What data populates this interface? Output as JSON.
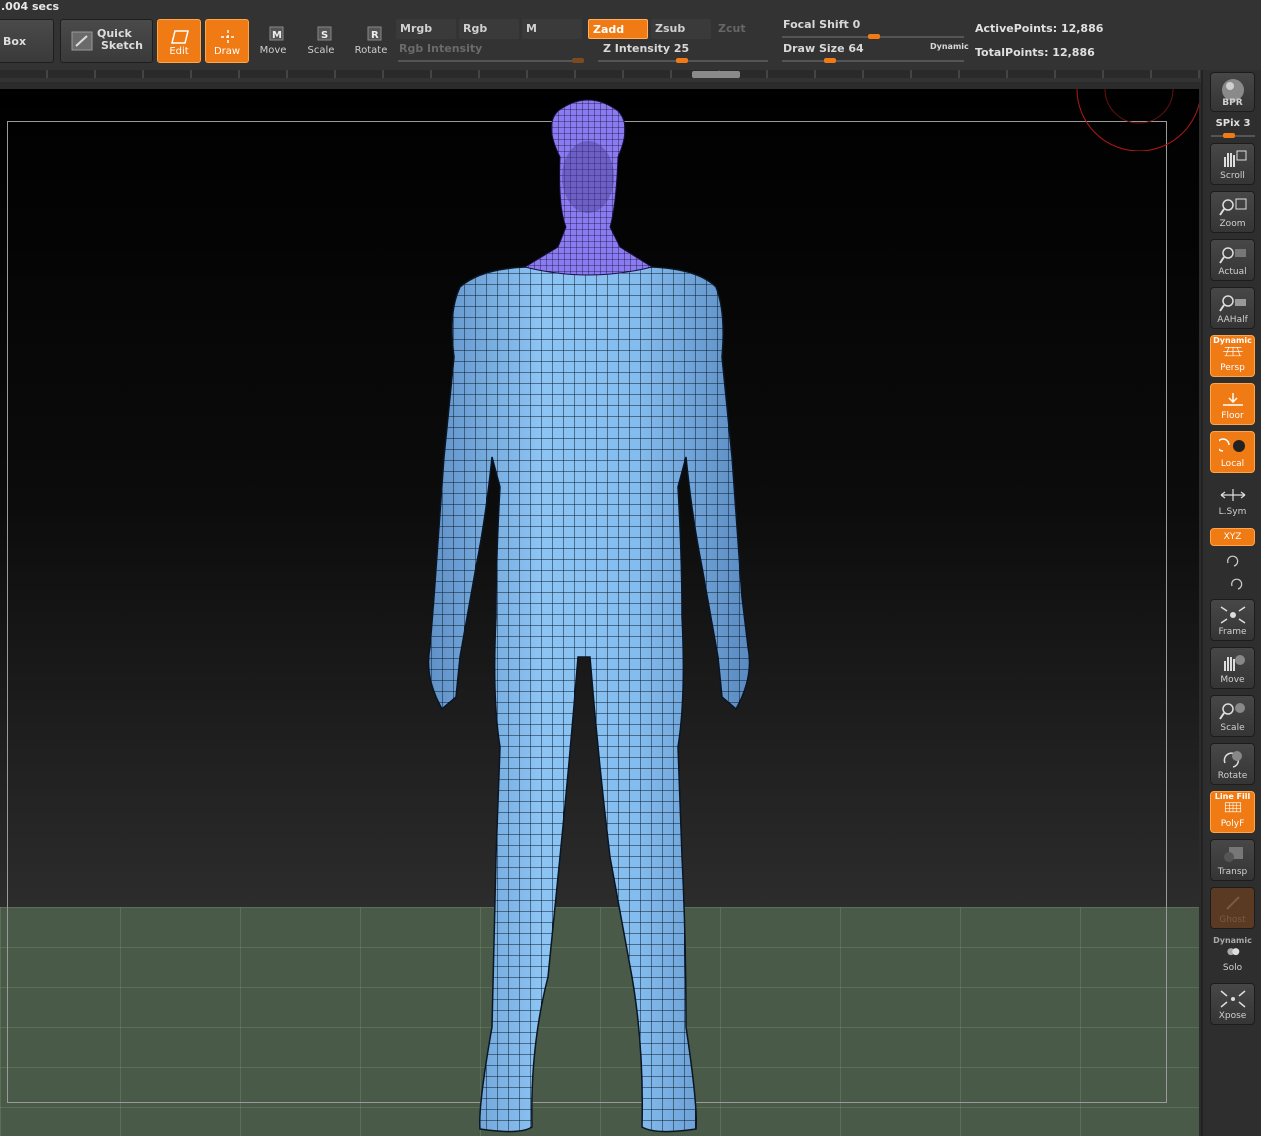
{
  "timer": ".004 secs",
  "top_buttons": {
    "box": "Box",
    "quick_sketch_1": "Quick",
    "quick_sketch_2": "Sketch",
    "edit": "Edit",
    "draw": "Draw",
    "move": "Move",
    "scale": "Scale",
    "rotate": "Rotate"
  },
  "modes": {
    "mrgb": "Mrgb",
    "rgb": "Rgb",
    "m": "M",
    "zadd": "Zadd",
    "zsub": "Zsub",
    "zcut": "Zcut"
  },
  "sliders": {
    "rgb_intensity": "Rgb  Intensity",
    "z_intensity": "Z  Intensity 25",
    "focal_shift": "Focal  Shift 0",
    "draw_size": "Draw  Size 64",
    "dynamic": "Dynamic"
  },
  "values": {
    "z_intensity": 25,
    "focal_shift": 0,
    "draw_size": 64
  },
  "info": {
    "active_points": "ActivePoints: 12,886",
    "total_points": "TotalPoints: 12,886"
  },
  "shelf": {
    "bpr": "BPR",
    "spix": "SPix 3",
    "scroll": "Scroll",
    "zoom": "Zoom",
    "actual": "Actual",
    "aahalf": "AAHalf",
    "persp_top": "Dynamic",
    "persp": "Persp",
    "floor": "Floor",
    "local": "Local",
    "lsym": "L.Sym",
    "xyz": "XYZ",
    "frame": "Frame",
    "move": "Move",
    "scale": "Scale",
    "rotate": "Rotate",
    "polyf_top": "Line Fill",
    "polyf": "PolyF",
    "transp": "Transp",
    "ghost": "Ghost",
    "solo_top": "Dynamic",
    "solo": "Solo",
    "xpose": "Xpose"
  },
  "colors": {
    "accent": "#f07a14",
    "mesh_body": "#7fb6ec",
    "mesh_masked": "#8a7cf0"
  }
}
